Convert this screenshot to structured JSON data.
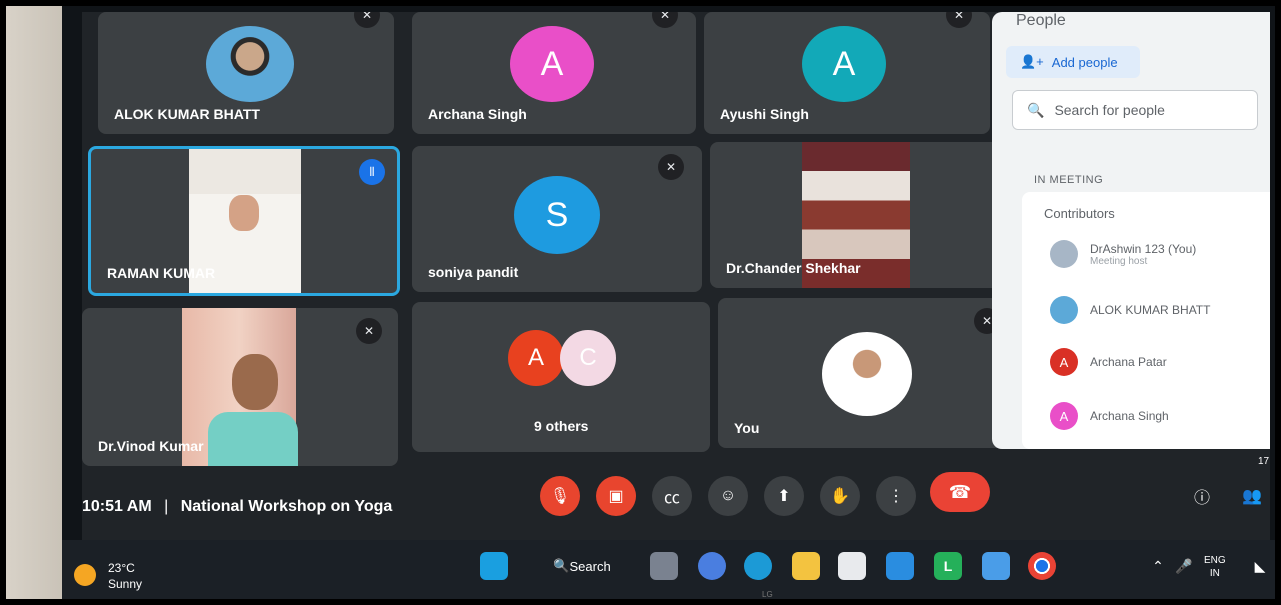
{
  "tiles": [
    {
      "name": "ALOK KUMAR BHATT",
      "kind": "photo-avatar"
    },
    {
      "name": "Archana Singh",
      "initial": "A",
      "color": "#e94fc8"
    },
    {
      "name": "Ayushi Singh",
      "initial": "A",
      "color": "#12a9b8"
    },
    {
      "name": "RAMAN KUMAR",
      "kind": "video",
      "speaking": true
    },
    {
      "name": "soniya pandit",
      "initial": "S",
      "color": "#1e9be0"
    },
    {
      "name": "Dr.Chander Shekhar",
      "kind": "video"
    },
    {
      "name": "Dr.Vinod Kumar",
      "kind": "video"
    },
    {
      "name": "9 others",
      "initials": [
        "A",
        "C"
      ],
      "colors": [
        "#e8411f",
        "#f3d9e4"
      ]
    },
    {
      "name": "You",
      "kind": "photo-avatar"
    }
  ],
  "people_panel": {
    "title": "People",
    "add_people": "Add people",
    "search_placeholder": "Search for people",
    "section": "IN MEETING",
    "group": "Contributors",
    "participants": [
      {
        "name": "DrAshwin 123 (You)",
        "sub": "Meeting host",
        "kind": "photo"
      },
      {
        "name": "ALOK KUMAR BHATT",
        "kind": "photo"
      },
      {
        "name": "Archana Patar",
        "initial": "A",
        "color": "#d93025"
      },
      {
        "name": "Archana Singh",
        "initial": "A",
        "color": "#e94fc8"
      }
    ]
  },
  "meeting": {
    "time": "10:51 AM",
    "separator": "|",
    "title": "National Workshop on Yoga"
  },
  "controls": [
    "mic-off-icon",
    "camera-off-icon",
    "captions-icon",
    "emoji-icon",
    "present-icon",
    "raise-hand-icon",
    "more-options-icon",
    "hang-up-icon"
  ],
  "side_controls": {
    "participant_count": "17"
  },
  "taskbar": {
    "weather_temp": "23°C",
    "weather_desc": "Sunny",
    "search_label": "Search",
    "lang_top": "ENG",
    "lang_bottom": "IN"
  },
  "monitor_brand": "LG"
}
